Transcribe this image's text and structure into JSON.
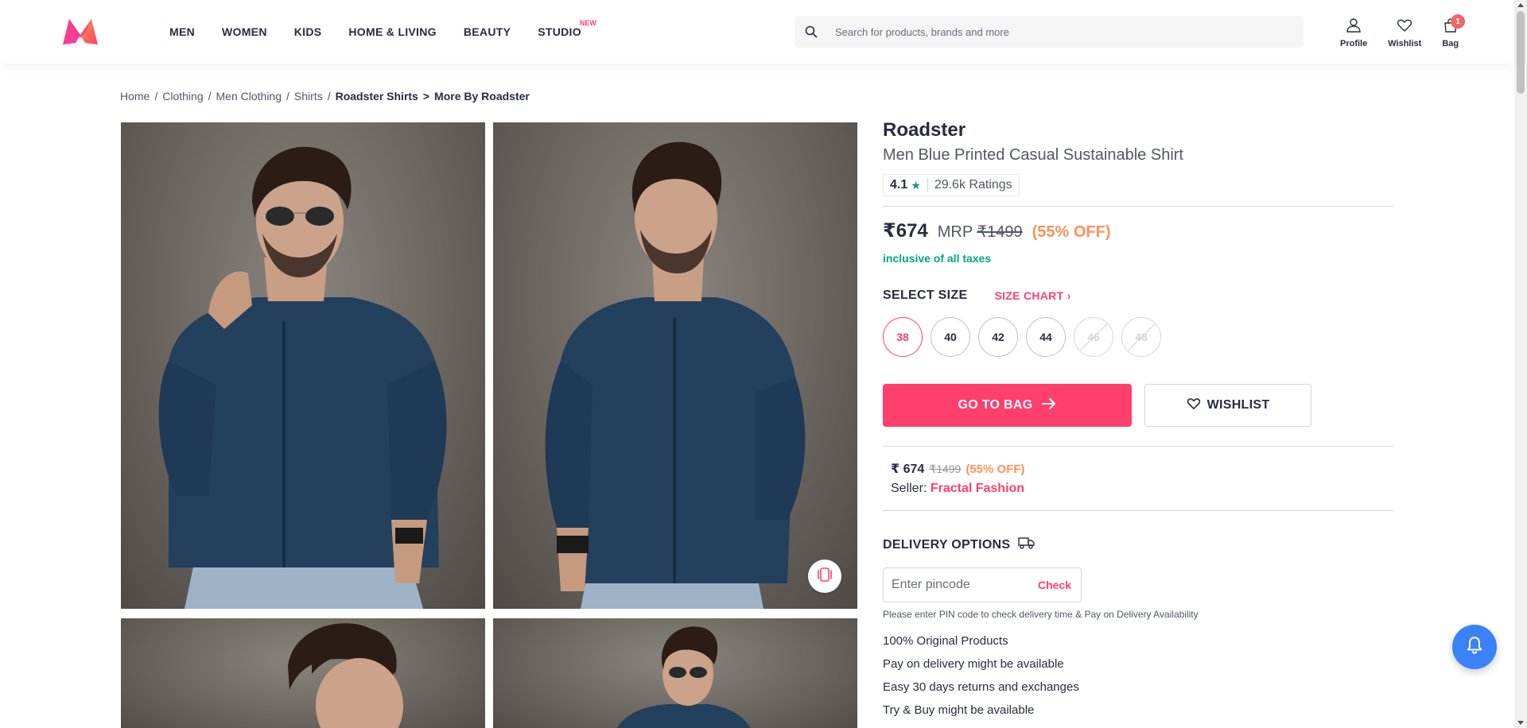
{
  "header": {
    "nav": [
      {
        "label": "MEN"
      },
      {
        "label": "WOMEN"
      },
      {
        "label": "KIDS"
      },
      {
        "label": "HOME & LIVING"
      },
      {
        "label": "BEAUTY"
      },
      {
        "label": "STUDIO",
        "badge": "NEW"
      }
    ],
    "search_placeholder": "Search for products, brands and more",
    "actions": {
      "profile": "Profile",
      "wishlist": "Wishlist",
      "bag": "Bag",
      "bag_count": "1"
    }
  },
  "breadcrumb": [
    {
      "label": "Home"
    },
    {
      "label": "Clothing"
    },
    {
      "label": "Men Clothing"
    },
    {
      "label": "Shirts"
    },
    {
      "label": "Roadster Shirts"
    },
    {
      "label": "More By Roadster"
    }
  ],
  "product": {
    "brand": "Roadster",
    "name": "Men Blue Printed Casual Sustainable Shirt",
    "rating": "4.1",
    "ratings_count": "29.6k Ratings",
    "price": "₹674",
    "mrp_label": "MRP",
    "mrp": "₹1499",
    "discount": "(55% OFF)",
    "tax_note": "inclusive of all taxes"
  },
  "size": {
    "title": "SELECT SIZE",
    "chart_label": "SIZE CHART",
    "options": [
      {
        "label": "38",
        "state": "selected"
      },
      {
        "label": "40",
        "state": "available"
      },
      {
        "label": "42",
        "state": "available"
      },
      {
        "label": "44",
        "state": "available"
      },
      {
        "label": "46",
        "state": "disabled"
      },
      {
        "label": "48",
        "state": "disabled"
      }
    ]
  },
  "buttons": {
    "bag": "GO TO BAG",
    "wishlist": "WISHLIST"
  },
  "seller_box": {
    "price": "₹ 674",
    "mrp": "₹1499",
    "discount": "(55% OFF)",
    "seller_label": "Seller:",
    "seller_name": "Fractal Fashion"
  },
  "delivery": {
    "title": "DELIVERY OPTIONS",
    "pin_placeholder": "Enter pincode",
    "check_label": "Check",
    "note": "Please enter PIN code to check delivery time & Pay on Delivery Availability"
  },
  "features": [
    "100% Original Products",
    "Pay on delivery might be available",
    "Easy 30 days returns and exchanges",
    "Try & Buy might be available"
  ],
  "icons": {
    "logo": "myntra-logo",
    "search": "search-icon",
    "profile": "profile-icon",
    "wishlist": "heart-icon",
    "bag": "bag-icon",
    "similar": "similar-products-icon",
    "arrow": "arrow-right-icon",
    "delivery": "truck-icon",
    "notification": "bell-icon"
  },
  "colors": {
    "accent": "#ff3f6c",
    "discount": "#ff905a",
    "tax": "#03a685",
    "rating_star": "#14958f",
    "fab": "#3b82f6"
  }
}
